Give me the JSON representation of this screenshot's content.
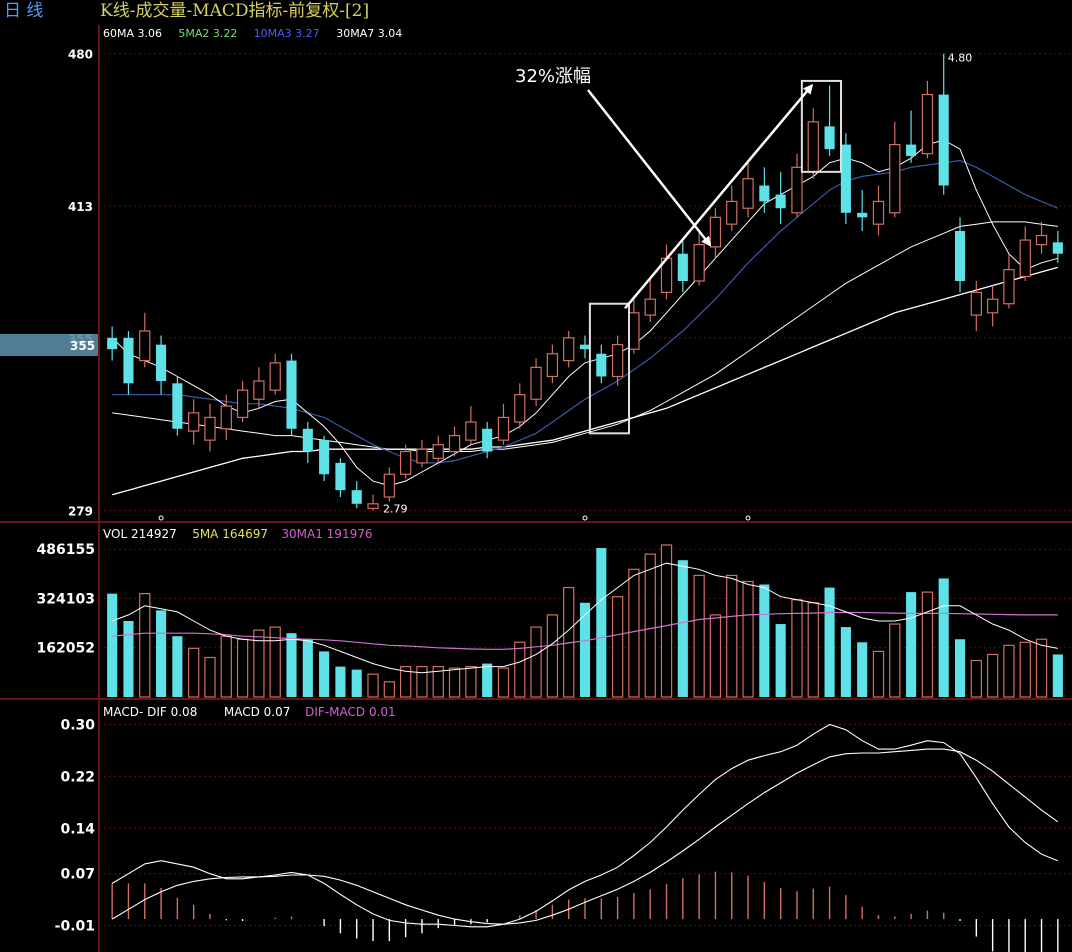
{
  "header": {
    "period_label": "日  线",
    "title": "K线-成交量-MACD指标-前复权-[2]"
  },
  "colors": {
    "up": "#d07060",
    "down": "#5fe1e8",
    "ma60": "#ffffff",
    "ma5": "#ffffff",
    "ma10": "#3a5aa8",
    "ma30": "#ffffff",
    "vol_ma5": "#ffffff",
    "vol_ma30": "#d070d0",
    "grid": "#5a1010",
    "axis_text": "#ffffff",
    "annotation": "#ffffff",
    "legend_60": "#ffffff",
    "legend_5": "#70e070",
    "legend_10": "#4060ff",
    "legend_30": "#ffffff",
    "legend_vol_ma5": "#e8e060",
    "legend_vol_ma30": "#d060d0",
    "legend_dif_macd": "#d060d0"
  },
  "price_panel": {
    "legend": [
      {
        "label": "60MA 3.06",
        "color_key": "legend_60"
      },
      {
        "label": "5MA2 3.22",
        "color_key": "legend_5"
      },
      {
        "label": "10MA3 3.27",
        "color_key": "legend_10"
      },
      {
        "label": "30MA7 3.04",
        "color_key": "legend_30"
      }
    ],
    "y_ticks": [
      "480",
      "413",
      "355",
      "279"
    ],
    "high_label": "4.80",
    "low_label": "2.79",
    "price_marker": "355",
    "annotation": "32%涨幅"
  },
  "volume_panel": {
    "legend": [
      {
        "label": "VOL 214927",
        "color_key": "axis_text"
      },
      {
        "label": "5MA 164697",
        "color_key": "legend_vol_ma5"
      },
      {
        "label": "30MA1 191976",
        "color_key": "legend_vol_ma30"
      }
    ],
    "y_ticks": [
      "486155",
      "324103",
      "162052"
    ]
  },
  "macd_panel": {
    "legend": [
      {
        "label": "MACD- DIF 0.08",
        "color_key": "axis_text"
      },
      {
        "label": "MACD 0.07",
        "color_key": "axis_text"
      },
      {
        "label": "DIF-MACD 0.01",
        "color_key": "legend_dif_macd"
      }
    ],
    "y_ticks": [
      "0.30",
      "0.22",
      "0.14",
      "0.07",
      "-0.01"
    ]
  },
  "chart_data": {
    "type": "candlestick",
    "price_range": [
      2.74,
      4.86
    ],
    "volume_range": [
      0,
      500000
    ],
    "macd_range": [
      -0.04,
      0.31
    ],
    "candles": [
      [
        3.55,
        3.5,
        3.6,
        3.45
      ],
      [
        3.55,
        3.35,
        3.58,
        3.3
      ],
      [
        3.45,
        3.58,
        3.66,
        3.42
      ],
      [
        3.52,
        3.36,
        3.56,
        3.3
      ],
      [
        3.35,
        3.15,
        3.38,
        3.12
      ],
      [
        3.14,
        3.22,
        3.28,
        3.08
      ],
      [
        3.1,
        3.2,
        3.26,
        3.05
      ],
      [
        3.15,
        3.25,
        3.3,
        3.1
      ],
      [
        3.2,
        3.32,
        3.36,
        3.18
      ],
      [
        3.28,
        3.36,
        3.42,
        3.24
      ],
      [
        3.32,
        3.44,
        3.48,
        3.3
      ],
      [
        3.45,
        3.15,
        3.48,
        3.12
      ],
      [
        3.15,
        3.05,
        3.18,
        3.0
      ],
      [
        3.1,
        2.95,
        3.12,
        2.92
      ],
      [
        3.0,
        2.88,
        3.02,
        2.85
      ],
      [
        2.88,
        2.82,
        2.92,
        2.8
      ],
      [
        2.8,
        2.82,
        2.86,
        2.79
      ],
      [
        2.85,
        2.95,
        2.98,
        2.83
      ],
      [
        2.95,
        3.05,
        3.08,
        2.93
      ],
      [
        3.0,
        3.06,
        3.1,
        2.98
      ],
      [
        3.02,
        3.08,
        3.12,
        3.0
      ],
      [
        3.05,
        3.12,
        3.16,
        3.03
      ],
      [
        3.1,
        3.18,
        3.25,
        3.08
      ],
      [
        3.15,
        3.05,
        3.18,
        3.02
      ],
      [
        3.1,
        3.2,
        3.26,
        3.08
      ],
      [
        3.18,
        3.3,
        3.35,
        3.15
      ],
      [
        3.28,
        3.42,
        3.46,
        3.25
      ],
      [
        3.38,
        3.48,
        3.52,
        3.35
      ],
      [
        3.45,
        3.55,
        3.58,
        3.42
      ],
      [
        3.52,
        3.5,
        3.56,
        3.46
      ],
      [
        3.48,
        3.38,
        3.52,
        3.35
      ],
      [
        3.38,
        3.52,
        3.56,
        3.34
      ],
      [
        3.5,
        3.66,
        3.72,
        3.48
      ],
      [
        3.65,
        3.72,
        3.82,
        3.62
      ],
      [
        3.75,
        3.9,
        3.96,
        3.72
      ],
      [
        3.92,
        3.8,
        3.98,
        3.75
      ],
      [
        3.8,
        3.96,
        4.02,
        3.78
      ],
      [
        3.95,
        4.08,
        4.12,
        3.9
      ],
      [
        4.05,
        4.15,
        4.22,
        4.02
      ],
      [
        4.12,
        4.25,
        4.32,
        4.08
      ],
      [
        4.22,
        4.15,
        4.3,
        4.1
      ],
      [
        4.18,
        4.12,
        4.28,
        4.05
      ],
      [
        4.1,
        4.3,
        4.36,
        4.08
      ],
      [
        4.28,
        4.5,
        4.56,
        4.25
      ],
      [
        4.48,
        4.38,
        4.66,
        4.35
      ],
      [
        4.4,
        4.1,
        4.45,
        4.05
      ],
      [
        4.1,
        4.08,
        4.2,
        4.02
      ],
      [
        4.05,
        4.15,
        4.22,
        4.0
      ],
      [
        4.1,
        4.4,
        4.5,
        4.08
      ],
      [
        4.4,
        4.35,
        4.55,
        4.32
      ],
      [
        4.36,
        4.62,
        4.68,
        4.34
      ],
      [
        4.62,
        4.22,
        4.8,
        4.18
      ],
      [
        4.02,
        3.8,
        4.08,
        3.75
      ],
      [
        3.65,
        3.75,
        3.8,
        3.58
      ],
      [
        3.66,
        3.72,
        3.78,
        3.6
      ],
      [
        3.7,
        3.85,
        3.92,
        3.68
      ],
      [
        3.82,
        3.98,
        4.04,
        3.8
      ],
      [
        3.96,
        4.0,
        4.06,
        3.92
      ],
      [
        3.97,
        3.92,
        4.02,
        3.88
      ]
    ],
    "volume": [
      340000,
      250000,
      340000,
      285000,
      200000,
      160000,
      130000,
      200000,
      190000,
      220000,
      230000,
      210000,
      190000,
      150000,
      100000,
      90000,
      75000,
      50000,
      100000,
      100000,
      100000,
      95000,
      100000,
      110000,
      95000,
      180000,
      230000,
      270000,
      360000,
      310000,
      490000,
      330000,
      420000,
      470000,
      500000,
      450000,
      400000,
      270000,
      400000,
      380000,
      370000,
      240000,
      320000,
      310000,
      360000,
      230000,
      180000,
      150000,
      240000,
      345000,
      345000,
      390000,
      190000,
      120000,
      140000,
      170000,
      180000,
      190000,
      140000
    ],
    "ma5": [
      3.55,
      3.48,
      3.45,
      3.42,
      3.38,
      3.34,
      3.3,
      3.25,
      3.22,
      3.24,
      3.27,
      3.28,
      3.22,
      3.16,
      3.08,
      2.98,
      2.92,
      2.9,
      2.92,
      2.96,
      3.0,
      3.04,
      3.08,
      3.1,
      3.12,
      3.16,
      3.22,
      3.3,
      3.38,
      3.44,
      3.46,
      3.48,
      3.52,
      3.58,
      3.66,
      3.74,
      3.82,
      3.9,
      3.98,
      4.06,
      4.14,
      4.18,
      4.22,
      4.26,
      4.32,
      4.34,
      4.32,
      4.28,
      4.3,
      4.34,
      4.4,
      4.42,
      4.38,
      4.2,
      4.05,
      3.92,
      3.85,
      3.88,
      3.9
    ],
    "ma10": [
      3.3,
      3.3,
      3.3,
      3.3,
      3.3,
      3.29,
      3.28,
      3.27,
      3.26,
      3.26,
      3.25,
      3.24,
      3.22,
      3.2,
      3.16,
      3.12,
      3.08,
      3.05,
      3.02,
      3.0,
      3.0,
      3.01,
      3.03,
      3.05,
      3.07,
      3.1,
      3.13,
      3.18,
      3.23,
      3.28,
      3.32,
      3.36,
      3.41,
      3.46,
      3.52,
      3.58,
      3.65,
      3.72,
      3.8,
      3.88,
      3.95,
      4.02,
      4.08,
      4.14,
      4.2,
      4.24,
      4.26,
      4.27,
      4.28,
      4.3,
      4.31,
      4.32,
      4.33,
      4.3,
      4.26,
      4.22,
      4.18,
      4.15,
      4.12
    ],
    "ma30": [
      3.22,
      3.21,
      3.2,
      3.19,
      3.18,
      3.17,
      3.16,
      3.15,
      3.14,
      3.13,
      3.12,
      3.12,
      3.11,
      3.1,
      3.09,
      3.08,
      3.07,
      3.06,
      3.06,
      3.05,
      3.05,
      3.05,
      3.05,
      3.06,
      3.06,
      3.07,
      3.08,
      3.09,
      3.11,
      3.13,
      3.15,
      3.17,
      3.2,
      3.23,
      3.27,
      3.31,
      3.35,
      3.39,
      3.44,
      3.49,
      3.54,
      3.59,
      3.64,
      3.69,
      3.74,
      3.79,
      3.83,
      3.87,
      3.91,
      3.95,
      3.98,
      4.01,
      4.04,
      4.05,
      4.06,
      4.06,
      4.06,
      4.05,
      4.04
    ],
    "ma60": [
      2.86,
      2.88,
      2.9,
      2.92,
      2.94,
      2.96,
      2.98,
      3.0,
      3.02,
      3.03,
      3.04,
      3.05,
      3.05,
      3.06,
      3.06,
      3.06,
      3.06,
      3.06,
      3.06,
      3.06,
      3.06,
      3.06,
      3.06,
      3.07,
      3.07,
      3.08,
      3.09,
      3.1,
      3.12,
      3.14,
      3.16,
      3.18,
      3.2,
      3.22,
      3.24,
      3.27,
      3.3,
      3.33,
      3.36,
      3.39,
      3.42,
      3.45,
      3.48,
      3.51,
      3.54,
      3.57,
      3.6,
      3.63,
      3.66,
      3.68,
      3.7,
      3.72,
      3.74,
      3.76,
      3.78,
      3.8,
      3.82,
      3.84,
      3.86
    ],
    "vol_ma5": [
      250000,
      270000,
      300000,
      290000,
      280000,
      250000,
      220000,
      200000,
      190000,
      185000,
      185000,
      190000,
      185000,
      170000,
      150000,
      130000,
      110000,
      95000,
      85000,
      80000,
      85000,
      90000,
      95000,
      100000,
      100000,
      115000,
      140000,
      175000,
      220000,
      270000,
      320000,
      360000,
      400000,
      420000,
      440000,
      430000,
      420000,
      400000,
      390000,
      370000,
      360000,
      330000,
      320000,
      310000,
      300000,
      280000,
      260000,
      250000,
      250000,
      260000,
      280000,
      300000,
      300000,
      270000,
      240000,
      220000,
      190000,
      170000,
      160000
    ],
    "vol_ma30": [
      200000,
      205000,
      210000,
      210000,
      210000,
      210000,
      208000,
      205000,
      200000,
      198000,
      195000,
      192000,
      190000,
      188000,
      185000,
      180000,
      175000,
      170000,
      168000,
      165000,
      162000,
      160000,
      158000,
      157000,
      157000,
      160000,
      165000,
      170000,
      178000,
      185000,
      195000,
      205000,
      215000,
      225000,
      235000,
      245000,
      255000,
      260000,
      265000,
      270000,
      272000,
      274000,
      275000,
      276000,
      278000,
      278000,
      278000,
      277000,
      276000,
      275000,
      275000,
      275000,
      274000,
      273000,
      272000,
      271000,
      270000,
      270000,
      270000
    ],
    "dif": [
      0.055,
      0.07,
      0.085,
      0.09,
      0.085,
      0.08,
      0.07,
      0.062,
      0.062,
      0.065,
      0.068,
      0.072,
      0.068,
      0.055,
      0.038,
      0.022,
      0.008,
      -0.002,
      -0.006,
      -0.008,
      -0.008,
      -0.01,
      -0.012,
      -0.012,
      -0.008,
      0.0,
      0.012,
      0.028,
      0.045,
      0.058,
      0.068,
      0.08,
      0.098,
      0.118,
      0.142,
      0.168,
      0.192,
      0.215,
      0.232,
      0.245,
      0.252,
      0.258,
      0.268,
      0.285,
      0.3,
      0.292,
      0.275,
      0.262,
      0.262,
      0.268,
      0.275,
      0.272,
      0.255,
      0.218,
      0.178,
      0.142,
      0.118,
      0.1,
      0.09
    ],
    "dea": [
      0.0,
      0.015,
      0.03,
      0.042,
      0.052,
      0.058,
      0.062,
      0.064,
      0.065,
      0.065,
      0.066,
      0.068,
      0.068,
      0.066,
      0.06,
      0.052,
      0.042,
      0.032,
      0.022,
      0.014,
      0.006,
      0.0,
      -0.004,
      -0.007,
      -0.008,
      -0.006,
      -0.002,
      0.006,
      0.015,
      0.026,
      0.036,
      0.046,
      0.058,
      0.072,
      0.088,
      0.105,
      0.123,
      0.142,
      0.16,
      0.178,
      0.195,
      0.21,
      0.225,
      0.238,
      0.25,
      0.255,
      0.256,
      0.256,
      0.258,
      0.26,
      0.262,
      0.262,
      0.258,
      0.245,
      0.228,
      0.208,
      0.188,
      0.168,
      0.15
    ],
    "macd_hist": [
      0.055,
      0.055,
      0.055,
      0.048,
      0.033,
      0.022,
      0.008,
      -0.002,
      -0.003,
      0.0,
      0.002,
      0.004,
      0.0,
      -0.011,
      -0.022,
      -0.03,
      -0.034,
      -0.034,
      -0.028,
      -0.022,
      -0.014,
      -0.01,
      -0.008,
      -0.005,
      0.0,
      0.006,
      0.014,
      0.022,
      0.03,
      0.032,
      0.032,
      0.034,
      0.04,
      0.046,
      0.054,
      0.063,
      0.069,
      0.073,
      0.072,
      0.067,
      0.057,
      0.048,
      0.043,
      0.047,
      0.05,
      0.037,
      0.019,
      0.006,
      0.004,
      0.008,
      0.013,
      0.01,
      -0.003,
      -0.027,
      -0.05,
      -0.066,
      -0.07,
      -0.068,
      -0.06
    ]
  }
}
